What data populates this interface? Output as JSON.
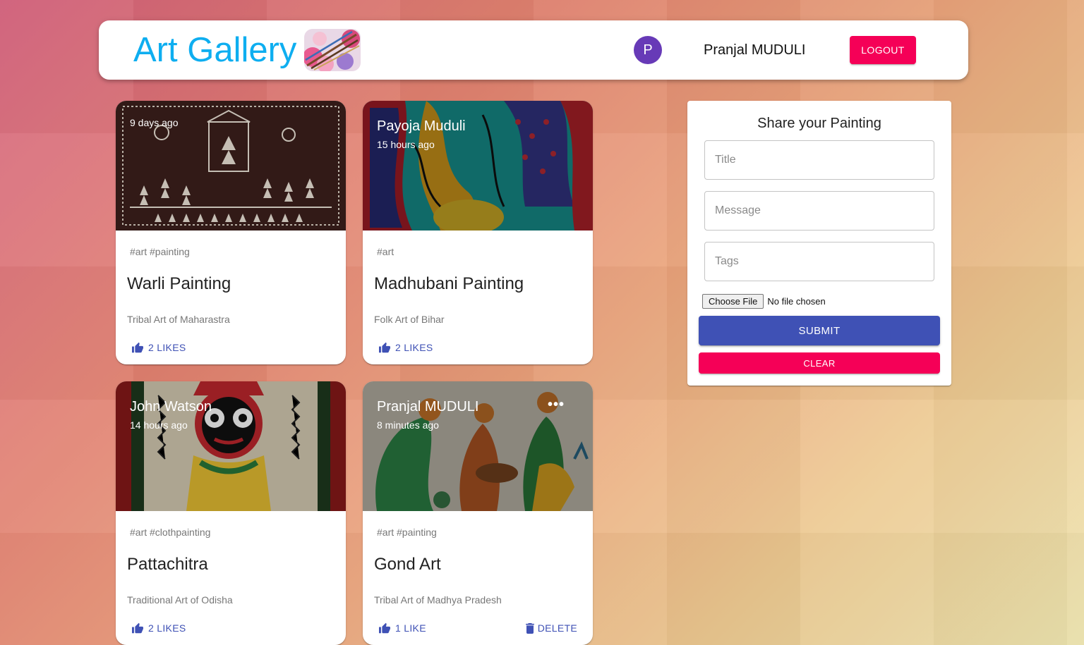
{
  "header": {
    "brand": "Art Gallery",
    "avatar_letter": "P",
    "user_name": "Pranjal MUDULI",
    "logout_label": "LOGOUT"
  },
  "posts": [
    {
      "author": "",
      "time": "9 days ago",
      "tags": "#art #painting",
      "title": "Warli Painting",
      "message": "Tribal Art of Maharastra",
      "likes": "2 LIKES"
    },
    {
      "author": "Payoja Muduli",
      "time": "15 hours ago",
      "tags": "#art",
      "title": "Madhubani Painting",
      "message": "Folk Art of Bihar",
      "likes": "2 LIKES"
    },
    {
      "author": "John Watson",
      "time": "14 hours ago",
      "tags": "#art #clothpainting",
      "title": "Pattachitra",
      "message": "Traditional Art of Odisha",
      "likes": "2 LIKES"
    },
    {
      "author": "Pranjal MUDULI",
      "time": "8 minutes ago",
      "more": "•••",
      "tags": "#art #painting",
      "title": "Gond Art",
      "message": "Tribal Art of Madhya Pradesh",
      "likes": "1 LIKE",
      "delete_label": "DELETE"
    }
  ],
  "form": {
    "title": "Share your Painting",
    "title_placeholder": "Title",
    "message_placeholder": "Message",
    "tags_placeholder": "Tags",
    "choose_file_label": "Choose File",
    "no_file_text": "No file chosen",
    "submit_label": "SUBMIT",
    "clear_label": "CLEAR"
  },
  "colors": {
    "brand": "#0eaef0",
    "primary": "#3f51b5",
    "secondary": "#f50057",
    "avatar": "#673ab7"
  }
}
